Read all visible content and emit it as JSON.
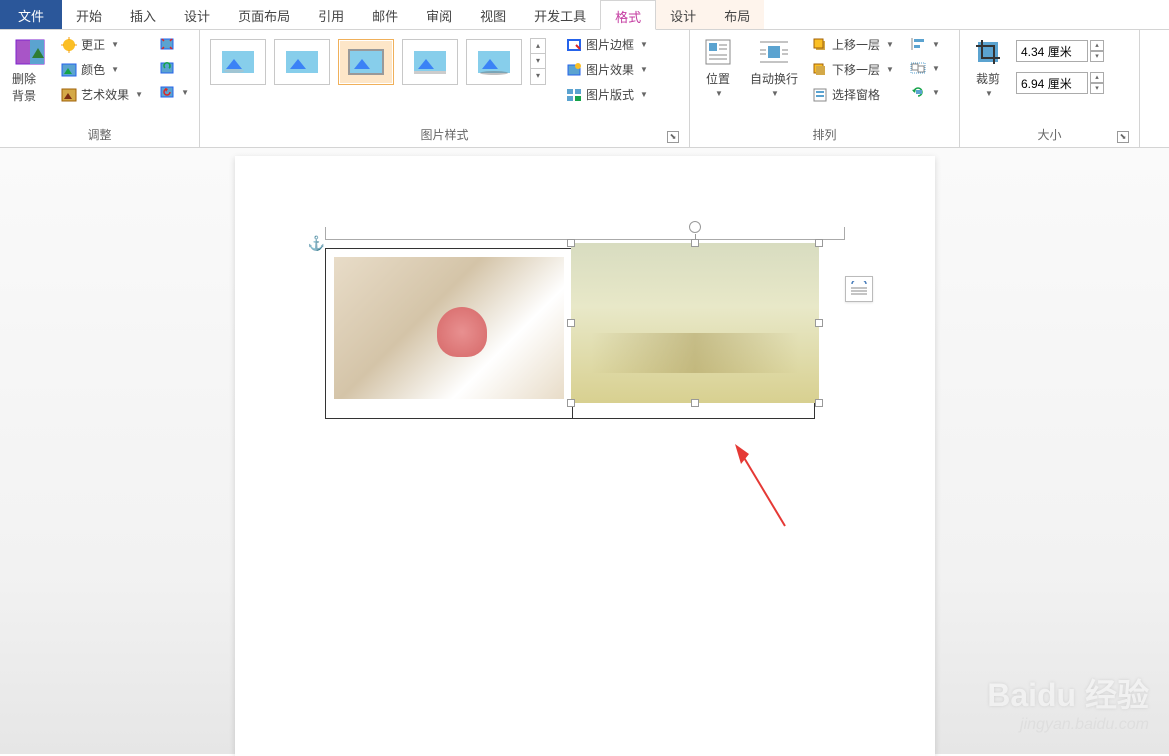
{
  "tabs": {
    "file": "文件",
    "home": "开始",
    "insert": "插入",
    "design": "设计",
    "layout": "页面布局",
    "references": "引用",
    "mailings": "邮件",
    "review": "审阅",
    "view": "视图",
    "developer": "开发工具",
    "format": "格式",
    "tbl_design": "设计",
    "tbl_layout": "布局"
  },
  "groups": {
    "adjust": {
      "label": "调整",
      "remove_bg": "删除背景",
      "corrections": "更正",
      "color": "颜色",
      "artistic": "艺术效果"
    },
    "styles": {
      "label": "图片样式",
      "border": "图片边框",
      "effects": "图片效果",
      "layout": "图片版式"
    },
    "arrange": {
      "label": "排列",
      "position": "位置",
      "wrap": "自动换行",
      "forward": "上移一层",
      "backward": "下移一层",
      "selection_pane": "选择窗格"
    },
    "size": {
      "label": "大小",
      "crop": "裁剪",
      "height": "4.34 厘米",
      "width": "6.94 厘米"
    }
  },
  "watermark": {
    "logo": "Baidu 经验",
    "url": "jingyan.baidu.com"
  }
}
